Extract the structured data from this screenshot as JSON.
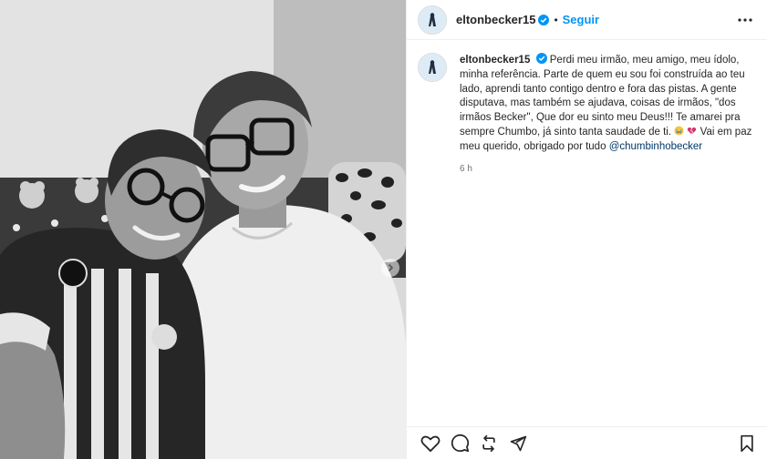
{
  "post": {
    "username": "eltonbecker15",
    "follow_label": "Seguir",
    "separator": "•",
    "caption_text": "Perdi meu irmão, meu amigo, meu ídolo, minha referência. Parte de quem eu sou foi construída ao teu lado, aprendi tanto contigo dentro e fora das pistas. A gente disputava, mas também se ajudava, coisas de irmãos, \"dos irmãos Becker\", Que dor eu sinto meu Deus!!! Te amarei pra sempre Chumbo, já sinto tanta saudade de ti.",
    "caption_after_emoji": "Vai em paz meu querido, obrigado por tudo",
    "mention": "@chumbinhobecker",
    "time": "6 h"
  },
  "media": {
    "type": "black-and-white photo",
    "description_icon": "photo"
  },
  "icons": {
    "more": "more-horizontal-icon",
    "like": "heart-icon",
    "comment": "comment-icon",
    "share": "share-icon",
    "save": "bookmark-icon",
    "verified": "verified-badge-icon"
  },
  "colors": {
    "accent": "#0095f6",
    "verified": "#0095f6",
    "mention": "#00376b",
    "muted": "#737373"
  }
}
